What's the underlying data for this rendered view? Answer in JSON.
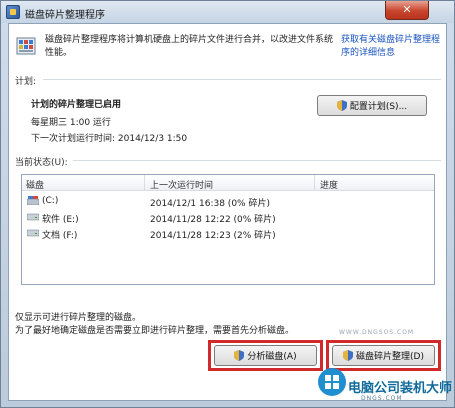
{
  "window": {
    "title": "磁盘碎片整理程序",
    "close_label": "✕"
  },
  "header": {
    "description": "磁盘碎片整理程序将计算机硬盘上的碎片文件进行合并，以改进文件系统性能。",
    "link": "获取有关磁盘碎片整理程序的详细信息"
  },
  "schedule": {
    "section_label": "计划:",
    "status": "计划的碎片整理已启用",
    "frequency": "每星期三  1:00 运行",
    "next_run": "下一次计划运行时间: 2014/12/3 1:50",
    "configure_button": "配置计划(S)..."
  },
  "current_status": {
    "section_label": "当前状态(U):",
    "columns": [
      "磁盘",
      "上一次运行时间",
      "进度"
    ],
    "rows": [
      {
        "disk": "(C:)",
        "last_run": "2014/12/1 16:38 (0% 碎片)",
        "progress": ""
      },
      {
        "disk": "软件 (E:)",
        "last_run": "2014/11/28 12:22 (0% 碎片)",
        "progress": ""
      },
      {
        "disk": "文档 (F:)",
        "last_run": "2014/11/28 12:23 (2% 碎片)",
        "progress": ""
      }
    ]
  },
  "footer": {
    "note1": "仅显示可进行碎片整理的磁盘。",
    "note2": "为了最好地确定磁盘是否需要立即进行碎片整理，需要首先分析磁盘。",
    "analyze_button": "分析磁盘(A)",
    "defrag_button": "磁盘碎片整理(D)"
  },
  "watermark": {
    "site": "WWW.DNGSOS.COM",
    "brand": "电脑公司装机大师",
    "brand_sub": "DNGS.COM"
  },
  "colors": {
    "highlight": "#d12a2a",
    "link": "#1a54c2"
  }
}
